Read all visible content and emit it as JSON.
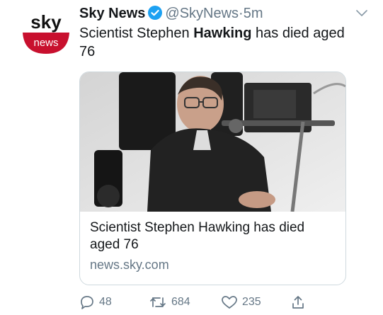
{
  "tweet": {
    "author_name": "Sky News",
    "handle": "@SkyNews",
    "separator": "·",
    "time": "5m",
    "text_before": "Scientist Stephen ",
    "text_bold": "Hawking",
    "text_after": " has died aged 76"
  },
  "avatar": {
    "logo_top": "sky",
    "logo_bottom": "news",
    "brand_red": "#c8102e"
  },
  "card": {
    "title": "Scientist Stephen Hawking has died aged 76",
    "domain": "news.sky.com",
    "image": "photo of Stephen Hawking in wheelchair"
  },
  "actions": {
    "reply_count": "48",
    "retweet_count": "684",
    "like_count": "235"
  },
  "colors": {
    "verified_blue": "#1da1f2",
    "muted_text": "#657786",
    "border": "#cfd9de"
  }
}
